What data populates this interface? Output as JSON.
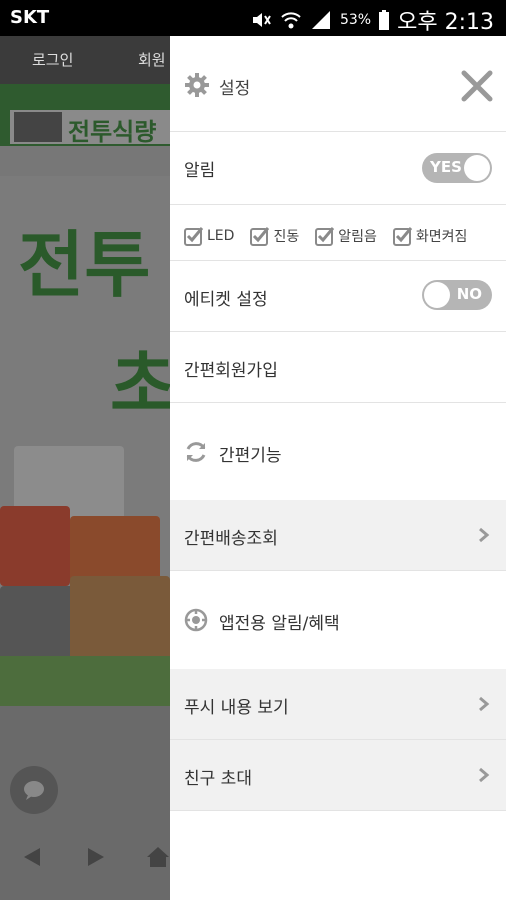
{
  "status_bar": {
    "carrier": "SKT",
    "battery": "53%",
    "time": "오후 2:13"
  },
  "background": {
    "nav_login": "로그인",
    "nav_member": "회원",
    "banner_text": "전투식량",
    "hero_line1": "전투",
    "hero_line2": "초"
  },
  "drawer": {
    "title": "설정",
    "notification": {
      "label": "알림",
      "toggle": "YES"
    },
    "checkboxes": [
      {
        "label": "LED",
        "checked": true
      },
      {
        "label": "진동",
        "checked": true
      },
      {
        "label": "알림음",
        "checked": true
      },
      {
        "label": "화면켜짐",
        "checked": true
      }
    ],
    "etiquette": {
      "label": "에티켓 설정",
      "toggle": "NO"
    },
    "signup": "간편회원가입",
    "quick_functions": "간편기능",
    "delivery_lookup": "간편배송조회",
    "app_benefits": "앱전용 알림/혜택",
    "push_view": "푸시 내용 보기",
    "invite_friend": "친구 초대"
  },
  "colors": {
    "toggle_bg": "#b5b5b5",
    "check_color": "#8a8a8a",
    "icon_grey": "#999999"
  }
}
